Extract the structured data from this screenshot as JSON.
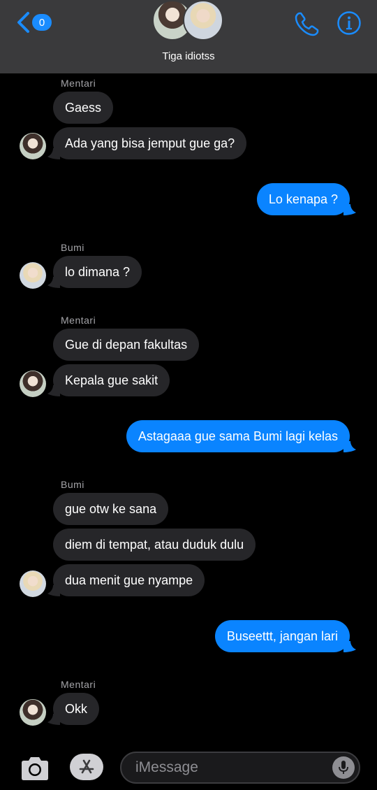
{
  "header": {
    "unread_count": "0",
    "group_name": "Tiga idiotss"
  },
  "messages": {
    "sender_1": "Mentari",
    "m1": "Gaess",
    "m2": "Ada yang bisa jemput gue ga?",
    "o1": "Lo kenapa ?",
    "sender_2": "Bumi",
    "m3": "lo dimana ?",
    "sender_3": "Mentari",
    "m4": "Gue di depan fakultas",
    "m5": "Kepala gue sakit",
    "o2": "Astagaaa gue sama Bumi lagi kelas",
    "sender_4": "Bumi",
    "m6": "gue otw ke sana",
    "m7": "diem di tempat, atau duduk dulu",
    "m8": "dua menit gue nyampe",
    "o3": "Buseettt, jangan lari",
    "sender_5": "Mentari",
    "m9": "Okk"
  },
  "input": {
    "placeholder": "iMessage"
  },
  "colors": {
    "accent": "#0a84ff",
    "header_bg": "#3a3a3c",
    "incoming_bubble": "#262629"
  },
  "icons": [
    "back-chevron-icon",
    "phone-icon",
    "info-icon",
    "camera-icon",
    "app-store-icon",
    "microphone-icon"
  ]
}
